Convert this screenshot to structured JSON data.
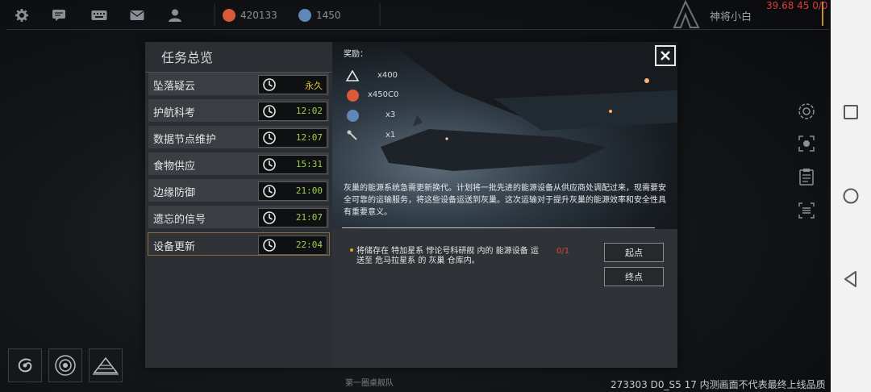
{
  "topbar": {
    "resources": [
      {
        "icon": "orange-token-icon",
        "value": "420133",
        "color": "#d9593a"
      },
      {
        "icon": "blue-token-icon",
        "value": "1450",
        "color": "#5f87b8"
      }
    ],
    "player_name": "神将小白",
    "fps": "39.68 45 0/0"
  },
  "panel": {
    "title": "任务总览",
    "tasks": [
      {
        "name": "坠落疑云",
        "time": "永久"
      },
      {
        "name": "护航科考",
        "time": "12:02"
      },
      {
        "name": "数据节点维护",
        "time": "12:07"
      },
      {
        "name": "食物供应",
        "time": "15:31"
      },
      {
        "name": "边缘防御",
        "time": "21:00"
      },
      {
        "name": "遗忘的信号",
        "time": "21:07"
      },
      {
        "name": "设备更新",
        "time": "22:04"
      }
    ],
    "reward_header": "奖励：",
    "rewards": [
      {
        "icon": "triangle-emblem-icon",
        "qty": "x400"
      },
      {
        "icon": "orange-token-icon",
        "qty": "x450C0"
      },
      {
        "icon": "blue-token-icon",
        "qty": "x3"
      },
      {
        "icon": "tool-icon",
        "qty": "x1"
      }
    ],
    "description": "灰巢的能源系统急需更新换代。计划将一批先进的能源设备从供应商处调配过来，现需要安全可靠的运输服务，将这些设备运送到灰巢。这次运输对于提升灰巢的能源效率和安全性具有重要意义。",
    "objective": "将储存在 特加星系 悖论号科研舰 内的 能源设备 运送至 危马拉星系 的 灰巢 仓库内。",
    "objective_count": "0/1",
    "start_button": "起点",
    "end_button": "终点"
  },
  "footer": {
    "sub_label": "第一圈桌舰队",
    "notice": "273303 D0_S5 17  内测画面不代表最终上线品质"
  }
}
